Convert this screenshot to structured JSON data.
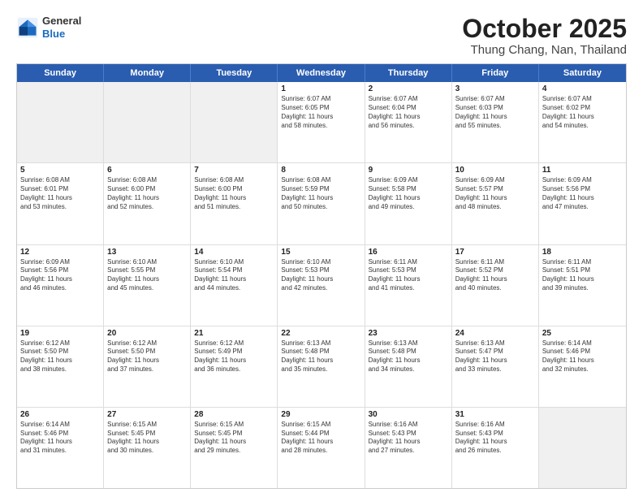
{
  "header": {
    "logo": {
      "line1": "General",
      "line2": "Blue"
    },
    "title": "October 2025",
    "location": "Thung Chang, Nan, Thailand"
  },
  "weekdays": [
    "Sunday",
    "Monday",
    "Tuesday",
    "Wednesday",
    "Thursday",
    "Friday",
    "Saturday"
  ],
  "rows": [
    [
      {
        "day": "",
        "text": "",
        "shaded": true
      },
      {
        "day": "",
        "text": "",
        "shaded": true
      },
      {
        "day": "",
        "text": "",
        "shaded": true
      },
      {
        "day": "1",
        "text": "Sunrise: 6:07 AM\nSunset: 6:05 PM\nDaylight: 11 hours\nand 58 minutes.",
        "shaded": false
      },
      {
        "day": "2",
        "text": "Sunrise: 6:07 AM\nSunset: 6:04 PM\nDaylight: 11 hours\nand 56 minutes.",
        "shaded": false
      },
      {
        "day": "3",
        "text": "Sunrise: 6:07 AM\nSunset: 6:03 PM\nDaylight: 11 hours\nand 55 minutes.",
        "shaded": false
      },
      {
        "day": "4",
        "text": "Sunrise: 6:07 AM\nSunset: 6:02 PM\nDaylight: 11 hours\nand 54 minutes.",
        "shaded": false
      }
    ],
    [
      {
        "day": "5",
        "text": "Sunrise: 6:08 AM\nSunset: 6:01 PM\nDaylight: 11 hours\nand 53 minutes.",
        "shaded": false
      },
      {
        "day": "6",
        "text": "Sunrise: 6:08 AM\nSunset: 6:00 PM\nDaylight: 11 hours\nand 52 minutes.",
        "shaded": false
      },
      {
        "day": "7",
        "text": "Sunrise: 6:08 AM\nSunset: 6:00 PM\nDaylight: 11 hours\nand 51 minutes.",
        "shaded": false
      },
      {
        "day": "8",
        "text": "Sunrise: 6:08 AM\nSunset: 5:59 PM\nDaylight: 11 hours\nand 50 minutes.",
        "shaded": false
      },
      {
        "day": "9",
        "text": "Sunrise: 6:09 AM\nSunset: 5:58 PM\nDaylight: 11 hours\nand 49 minutes.",
        "shaded": false
      },
      {
        "day": "10",
        "text": "Sunrise: 6:09 AM\nSunset: 5:57 PM\nDaylight: 11 hours\nand 48 minutes.",
        "shaded": false
      },
      {
        "day": "11",
        "text": "Sunrise: 6:09 AM\nSunset: 5:56 PM\nDaylight: 11 hours\nand 47 minutes.",
        "shaded": false
      }
    ],
    [
      {
        "day": "12",
        "text": "Sunrise: 6:09 AM\nSunset: 5:56 PM\nDaylight: 11 hours\nand 46 minutes.",
        "shaded": false
      },
      {
        "day": "13",
        "text": "Sunrise: 6:10 AM\nSunset: 5:55 PM\nDaylight: 11 hours\nand 45 minutes.",
        "shaded": false
      },
      {
        "day": "14",
        "text": "Sunrise: 6:10 AM\nSunset: 5:54 PM\nDaylight: 11 hours\nand 44 minutes.",
        "shaded": false
      },
      {
        "day": "15",
        "text": "Sunrise: 6:10 AM\nSunset: 5:53 PM\nDaylight: 11 hours\nand 42 minutes.",
        "shaded": false
      },
      {
        "day": "16",
        "text": "Sunrise: 6:11 AM\nSunset: 5:53 PM\nDaylight: 11 hours\nand 41 minutes.",
        "shaded": false
      },
      {
        "day": "17",
        "text": "Sunrise: 6:11 AM\nSunset: 5:52 PM\nDaylight: 11 hours\nand 40 minutes.",
        "shaded": false
      },
      {
        "day": "18",
        "text": "Sunrise: 6:11 AM\nSunset: 5:51 PM\nDaylight: 11 hours\nand 39 minutes.",
        "shaded": false
      }
    ],
    [
      {
        "day": "19",
        "text": "Sunrise: 6:12 AM\nSunset: 5:50 PM\nDaylight: 11 hours\nand 38 minutes.",
        "shaded": false
      },
      {
        "day": "20",
        "text": "Sunrise: 6:12 AM\nSunset: 5:50 PM\nDaylight: 11 hours\nand 37 minutes.",
        "shaded": false
      },
      {
        "day": "21",
        "text": "Sunrise: 6:12 AM\nSunset: 5:49 PM\nDaylight: 11 hours\nand 36 minutes.",
        "shaded": false
      },
      {
        "day": "22",
        "text": "Sunrise: 6:13 AM\nSunset: 5:48 PM\nDaylight: 11 hours\nand 35 minutes.",
        "shaded": false
      },
      {
        "day": "23",
        "text": "Sunrise: 6:13 AM\nSunset: 5:48 PM\nDaylight: 11 hours\nand 34 minutes.",
        "shaded": false
      },
      {
        "day": "24",
        "text": "Sunrise: 6:13 AM\nSunset: 5:47 PM\nDaylight: 11 hours\nand 33 minutes.",
        "shaded": false
      },
      {
        "day": "25",
        "text": "Sunrise: 6:14 AM\nSunset: 5:46 PM\nDaylight: 11 hours\nand 32 minutes.",
        "shaded": false
      }
    ],
    [
      {
        "day": "26",
        "text": "Sunrise: 6:14 AM\nSunset: 5:46 PM\nDaylight: 11 hours\nand 31 minutes.",
        "shaded": false
      },
      {
        "day": "27",
        "text": "Sunrise: 6:15 AM\nSunset: 5:45 PM\nDaylight: 11 hours\nand 30 minutes.",
        "shaded": false
      },
      {
        "day": "28",
        "text": "Sunrise: 6:15 AM\nSunset: 5:45 PM\nDaylight: 11 hours\nand 29 minutes.",
        "shaded": false
      },
      {
        "day": "29",
        "text": "Sunrise: 6:15 AM\nSunset: 5:44 PM\nDaylight: 11 hours\nand 28 minutes.",
        "shaded": false
      },
      {
        "day": "30",
        "text": "Sunrise: 6:16 AM\nSunset: 5:43 PM\nDaylight: 11 hours\nand 27 minutes.",
        "shaded": false
      },
      {
        "day": "31",
        "text": "Sunrise: 6:16 AM\nSunset: 5:43 PM\nDaylight: 11 hours\nand 26 minutes.",
        "shaded": false
      },
      {
        "day": "",
        "text": "",
        "shaded": true
      }
    ]
  ]
}
